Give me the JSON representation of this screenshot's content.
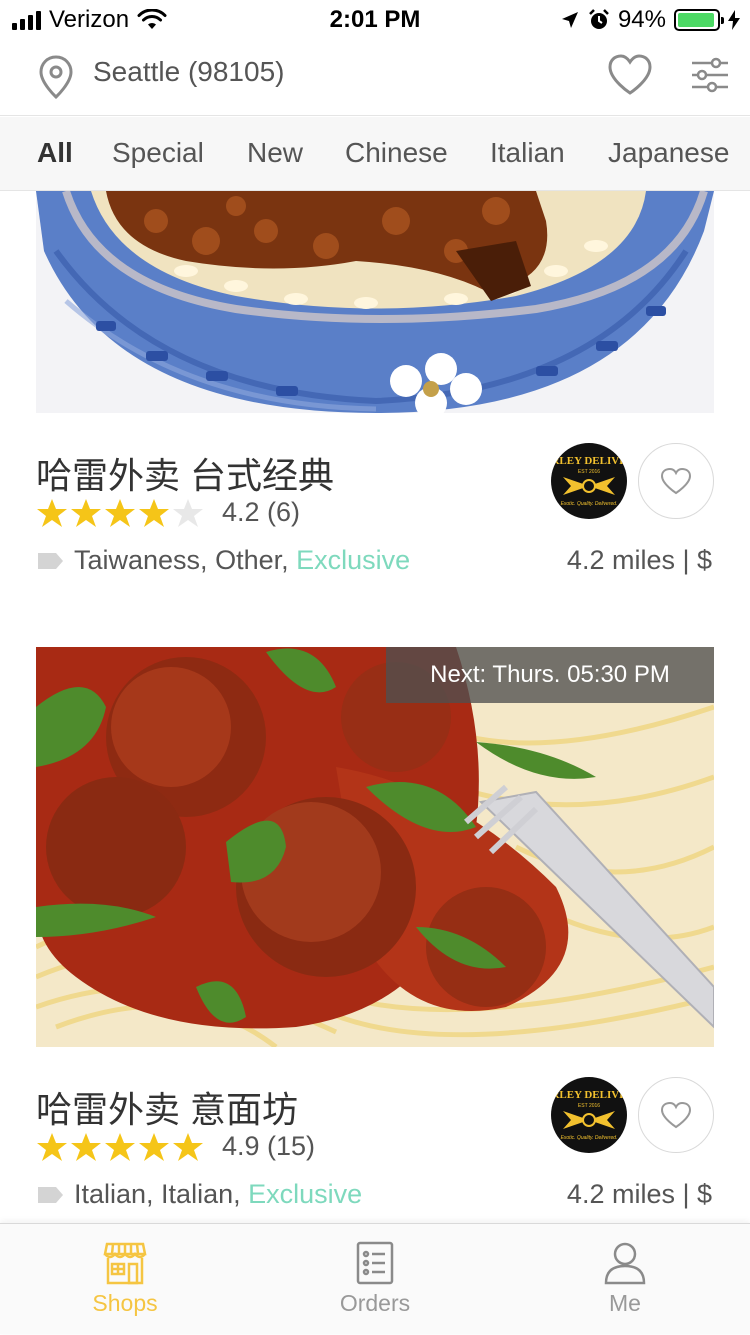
{
  "status_bar": {
    "carrier": "Verizon",
    "time": "2:01 PM",
    "battery": "94%"
  },
  "header": {
    "location": "Seattle (98105)",
    "icons": [
      "location-pin-icon",
      "heart-icon",
      "filter-sliders-icon"
    ]
  },
  "tabs": [
    {
      "label": "All",
      "active": true
    },
    {
      "label": "Special"
    },
    {
      "label": "New"
    },
    {
      "label": "Chinese"
    },
    {
      "label": "Italian"
    },
    {
      "label": "Japanese"
    }
  ],
  "shops": [
    {
      "name": "哈雷外卖 台式经典",
      "rating": 4.2,
      "rating_text": "4.2 (6)",
      "tags": "Taiwaness, Other,",
      "exclusive": "Exclusive",
      "distance": "4.2 miles | $",
      "logo": {
        "text": "RLEY DELIVE",
        "sub": "EST 2016",
        "tagline": "Exotic. Quality. Delivered."
      }
    },
    {
      "name": "哈雷外卖 意面坊",
      "rating": 4.9,
      "rating_text": "4.9 (15)",
      "tags": "Italian, Italian,",
      "exclusive": "Exclusive",
      "distance": "4.2 miles | $",
      "next": "Next: Thurs. 05:30 PM",
      "logo": {
        "text": "RLEY DELIVE",
        "sub": "EST 2016",
        "tagline": "Exotic. Quality. Delivered."
      }
    }
  ],
  "tabbar": [
    {
      "label": "Shops",
      "icon": "shop-icon",
      "active": true
    },
    {
      "label": "Orders",
      "icon": "orders-list-icon"
    },
    {
      "label": "Me",
      "icon": "person-icon"
    }
  ],
  "colors": {
    "accent": "#f5c542",
    "exclusive": "#7ed9bd",
    "star": "#f5c518",
    "battery": "#4cd964"
  }
}
